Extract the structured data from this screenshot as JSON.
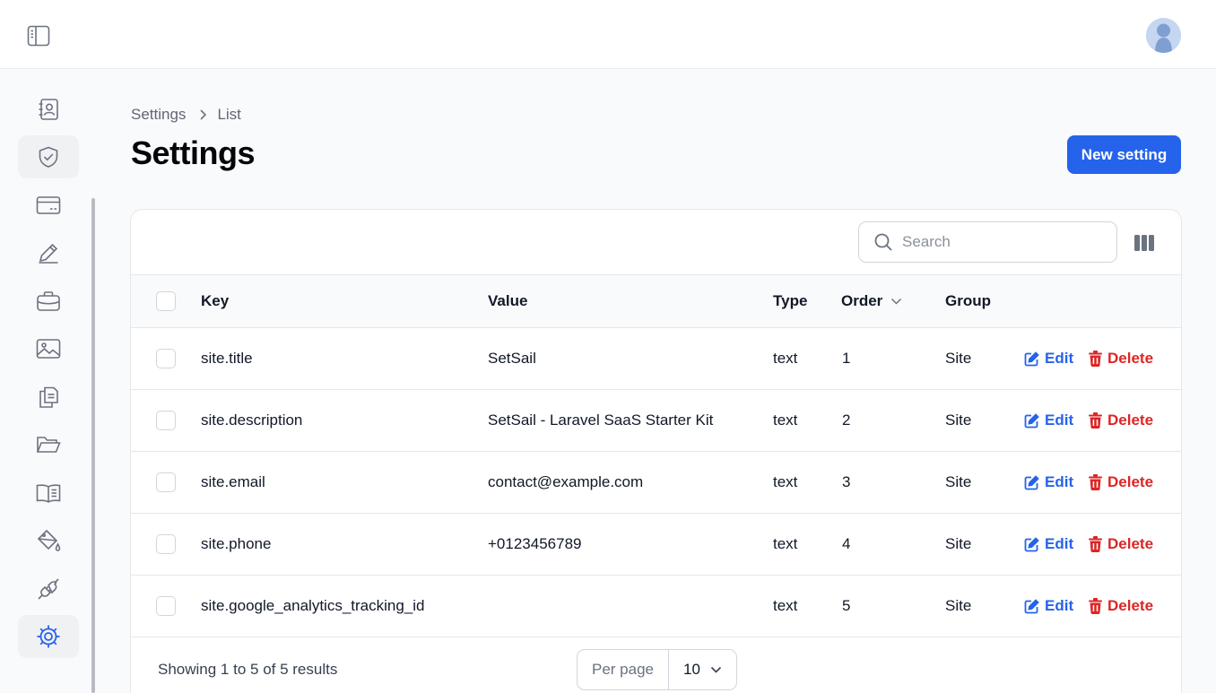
{
  "header": {
    "sidebar_toggle_icon": "sidebar-toggle-icon",
    "avatar_icon": "user-avatar"
  },
  "sidebar": {
    "items": [
      {
        "icon": "contacts-icon",
        "active": false
      },
      {
        "icon": "shield-check-icon",
        "active": false
      },
      {
        "icon": "credit-card-icon",
        "active": false
      },
      {
        "icon": "pencil-icon",
        "active": false
      },
      {
        "icon": "briefcase-icon",
        "active": false
      },
      {
        "icon": "image-icon",
        "active": false
      },
      {
        "icon": "documents-icon",
        "active": false
      },
      {
        "icon": "folder-open-icon",
        "active": false
      },
      {
        "icon": "book-open-icon",
        "active": false
      },
      {
        "icon": "paint-bucket-icon",
        "active": false
      },
      {
        "icon": "plug-icon",
        "active": false
      },
      {
        "icon": "gear-icon",
        "active": true
      }
    ]
  },
  "breadcrumb": {
    "items": [
      "Settings",
      "List"
    ]
  },
  "page": {
    "title": "Settings",
    "new_button": "New setting"
  },
  "table": {
    "search_placeholder": "Search",
    "columns": [
      "Key",
      "Value",
      "Type",
      "Order",
      "Group"
    ],
    "sort_column": "Order",
    "actions": {
      "edit": "Edit",
      "delete": "Delete"
    },
    "rows": [
      {
        "key": "site.title",
        "value": "SetSail",
        "type": "text",
        "order": "1",
        "group": "Site"
      },
      {
        "key": "site.description",
        "value": "SetSail - Laravel SaaS Starter Kit",
        "type": "text",
        "order": "2",
        "group": "Site"
      },
      {
        "key": "site.email",
        "value": "contact@example.com",
        "type": "text",
        "order": "3",
        "group": "Site"
      },
      {
        "key": "site.phone",
        "value": "+0123456789",
        "type": "text",
        "order": "4",
        "group": "Site"
      },
      {
        "key": "site.google_analytics_tracking_id",
        "value": "",
        "type": "text",
        "order": "5",
        "group": "Site"
      }
    ]
  },
  "footer": {
    "summary": "Showing 1 to 5 of 5 results",
    "per_page_label": "Per page",
    "per_page_value": "10"
  },
  "colors": {
    "primary": "#2563eb",
    "danger": "#dc2626",
    "active_icon": "#2563eb"
  }
}
